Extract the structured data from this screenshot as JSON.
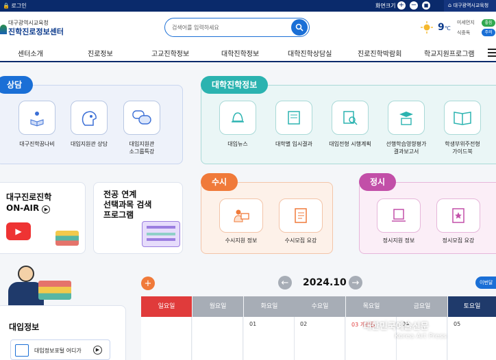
{
  "topbar": {
    "login": "로그인",
    "font_size": "화면크기",
    "zoom_in": "+",
    "zoom_out": "−",
    "reset": "■",
    "edu_office": "대구광역시교육청"
  },
  "header": {
    "logo_sub": "대구광역시교육청",
    "logo_main": "진학진로정보센터",
    "search_placeholder": "검색어를 입력하세요",
    "temp": "9",
    "temp_unit": "℃",
    "air1": "미세먼지",
    "air2": "식중독",
    "badge1": "좋음",
    "badge2": "주의"
  },
  "nav": [
    "센터소개",
    "진로정보",
    "고교진학정보",
    "대학진학정보",
    "대학진학상담실",
    "진로진학박람회",
    "학교지원프로그램"
  ],
  "counsel": {
    "title": "상담",
    "items": [
      "대구진학꿈나비",
      "대입지원관 상담",
      "대입지원관\n소그룹특강"
    ]
  },
  "univ": {
    "title": "대학진학정보",
    "items": [
      "대입뉴스",
      "대학별 입시결과",
      "대입전형 시행계획",
      "선행학습영향평가\n결과보고서",
      "학생부위주전형\n가이드북"
    ]
  },
  "onair": {
    "line1": "대구진로진학",
    "line2": "ON-AIR"
  },
  "major": {
    "line1": "전공 연계",
    "line2": "선택과목 검색",
    "line3": "프로그램"
  },
  "susi": {
    "title": "수시",
    "items": [
      "수시지원 정보",
      "수시모집 요강"
    ]
  },
  "jeongsi": {
    "title": "정시",
    "items": [
      "정시지원 정보",
      "정시모집 요강"
    ]
  },
  "calendar": {
    "month": "2024.10",
    "prev_label": "이번달",
    "days": [
      "일요일",
      "월요일",
      "화요일",
      "수요일",
      "목요일",
      "금요일",
      "토요일"
    ],
    "dates": [
      "",
      "",
      "01",
      "02",
      "03 개천절",
      "04",
      "05"
    ]
  },
  "admission": {
    "title": "대입정보",
    "link": "대입정보포털 어디가"
  },
  "watermark": {
    "line1": "대한민국예술신문",
    "line2": "Korea Art Press"
  },
  "colors": {
    "navy": "#0a2a6b",
    "blue": "#1a6fd6",
    "teal": "#2bb3b0",
    "orange": "#f07a3a",
    "pink": "#c24fa8",
    "red": "#e03b3b"
  }
}
